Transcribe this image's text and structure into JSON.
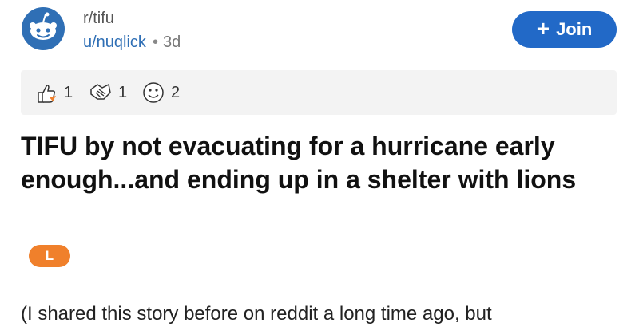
{
  "post": {
    "subreddit": "r/tifu",
    "author": "u/nuqlick",
    "separator": "•",
    "age": "3d",
    "join_label": "Join",
    "join_icon": "+",
    "awards": [
      {
        "icon": "thumbs-up-rocket-icon",
        "count": "1"
      },
      {
        "icon": "handshake-icon",
        "count": "1"
      },
      {
        "icon": "smiley-face-icon",
        "count": "2"
      }
    ],
    "title": "TIFU by not evacuating for a hurricane early enough...and ending up in a shelter with lions",
    "flair": "L",
    "body_preview": "(I shared this story before on reddit a long time ago, but"
  },
  "colors": {
    "accent": "#2269c7",
    "subreddit_icon": "#2f6fb5",
    "flair": "#f0802b",
    "awards_bg": "#f3f3f3"
  }
}
